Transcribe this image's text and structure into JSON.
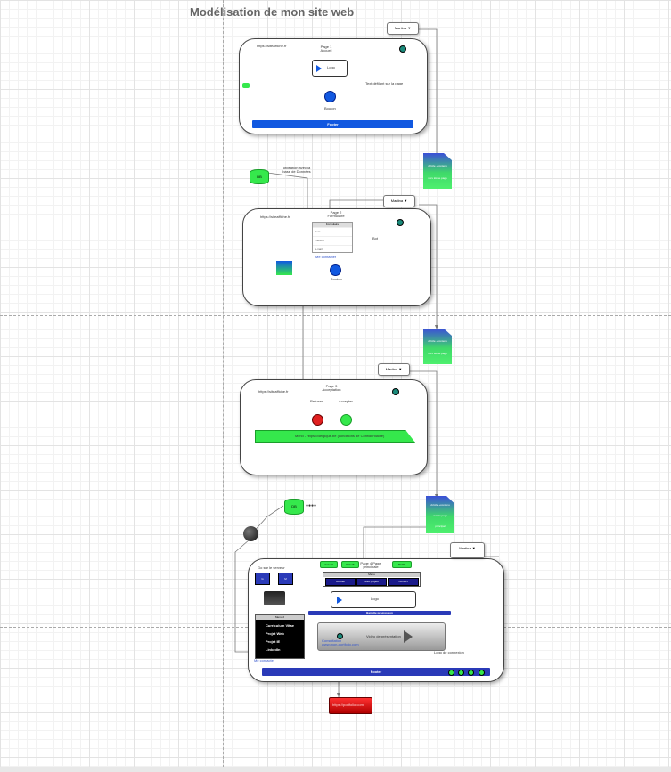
{
  "title": "Modélisation de mon site web",
  "colors": {
    "accent_blue": "#1158e0",
    "green": "#35e84c",
    "red": "#e02020",
    "teal": "#1a8a7a"
  },
  "page1": {
    "url": "https://siteaffiche.fr",
    "name": "Page 1 Accueil",
    "logo": "Logo",
    "button": "Bouton",
    "transition": "Text défilant sur la page",
    "footer": "Footer",
    "callout": "Martina ▼"
  },
  "doc1": {
    "line1": "Article +contenu",
    "line2": "vers 2ème page"
  },
  "db1": {
    "label": "DB",
    "note": "utilisation avec la base de Données"
  },
  "page2": {
    "url": "https://siteaffiche.fr",
    "name": "Page 2 Formulaire",
    "form_title": "Formulaire",
    "fields": [
      "Nom",
      "Prénom",
      "E-mail"
    ],
    "link": "Me contacter",
    "button": "Bouton",
    "transition": "Bot",
    "callout": "Martina ▼"
  },
  "doc2": {
    "line1": "Article +contenu",
    "line2": "vers 3ème page"
  },
  "page3": {
    "url": "https://siteaffiche.fr",
    "name": "Page 3 Acceptation",
    "refuse": "Refuser",
    "accept": "Accepter",
    "banner": "Merci - https://Belgique.be (conditions de Confidentialité)",
    "callout": "Martina ▼"
  },
  "doc3": {
    "line1": "Article +contenu",
    "line2": "vers la page",
    "line3": "principal"
  },
  "db2": {
    "label": "DB",
    "dots": "●●●●"
  },
  "page4": {
    "name": "Page 4 Page principale",
    "callout": "Martina ▼",
    "nav_tabs": [
      "Menu",
      "Accueil",
      "Mes projets",
      "Contact"
    ],
    "menu_title": "Menu",
    "menu_items": [
      "Accueil",
      "Historik",
      "Profils"
    ],
    "search_label": "Go sur le serveur",
    "icons": [
      "G",
      "M"
    ],
    "logo": "Logo",
    "progress_label": "Barrette progression",
    "list_title": "Menu 2",
    "list_items": [
      "Curriculum Vitae",
      "Projet Web",
      "Projet IE",
      "LinkedIn"
    ],
    "link": "Me contacter",
    "video": "Vidéo de présentation",
    "video_caption": "Consultation\nwww.mon-portfolio.com",
    "link2": "Logo de connexion",
    "footer": "Footer"
  },
  "redbtn": "https://portfolio.com"
}
